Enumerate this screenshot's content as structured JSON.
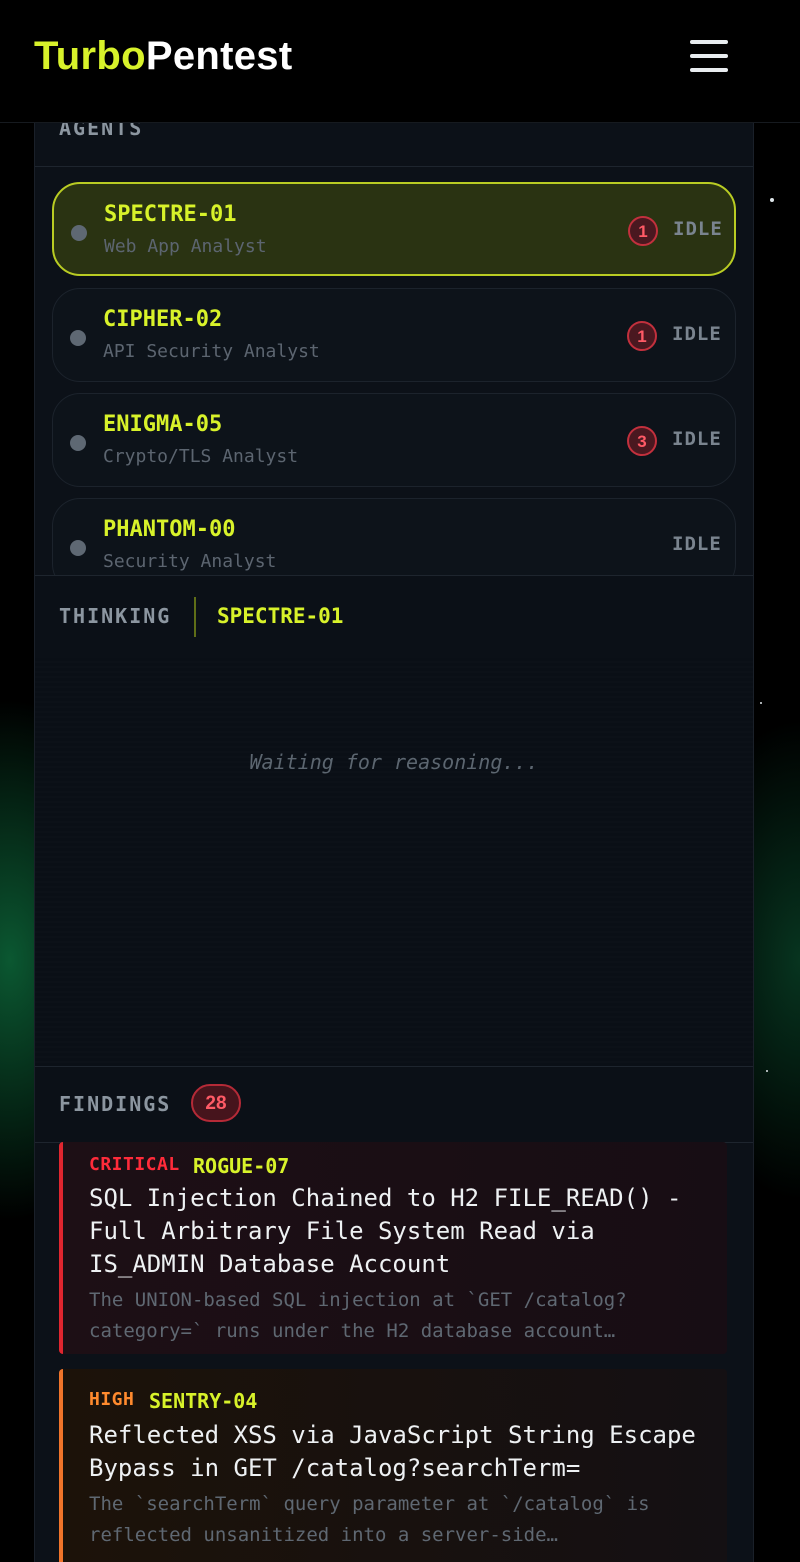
{
  "header": {
    "logo_part1": "Turbo",
    "logo_part2": "Pentest",
    "menu_icon": "hamburger-menu-icon"
  },
  "agents": {
    "label": "AGENTS",
    "items": [
      {
        "name": "SPECTRE-01",
        "role": "Web App Analyst",
        "count": "1",
        "status": "IDLE",
        "selected": true
      },
      {
        "name": "CIPHER-02",
        "role": "API Security Analyst",
        "count": "1",
        "status": "IDLE",
        "selected": false
      },
      {
        "name": "ENIGMA-05",
        "role": "Crypto/TLS Analyst",
        "count": "3",
        "status": "IDLE",
        "selected": false
      },
      {
        "name": "PHANTOM-00",
        "role": "Security Analyst",
        "count": "",
        "status": "IDLE",
        "selected": false
      }
    ]
  },
  "thinking": {
    "label": "THINKING",
    "agent": "SPECTRE-01",
    "placeholder": "Waiting for reasoning..."
  },
  "findings": {
    "label": "FINDINGS",
    "count": "28",
    "items": [
      {
        "severity": "CRITICAL",
        "agent": "ROGUE-07",
        "title": "SQL Injection Chained to H2 FILE_READ() - Full Arbitrary File System Read via IS_ADMIN Database Account",
        "description": "The UNION-based SQL injection at `GET /catalog?category=` runs under the H2 database account…"
      },
      {
        "severity": "HIGH",
        "agent": "SENTRY-04",
        "title": "Reflected XSS via JavaScript String Escape Bypass in GET /catalog?searchTerm=",
        "description": "The `searchTerm` query parameter at `/catalog` is reflected unsanitized into a server-side…"
      }
    ]
  },
  "colors": {
    "accent": "#d8f22a",
    "critical": "#ff2b3a",
    "high": "#ff8a2e",
    "background": "#0c1118"
  }
}
